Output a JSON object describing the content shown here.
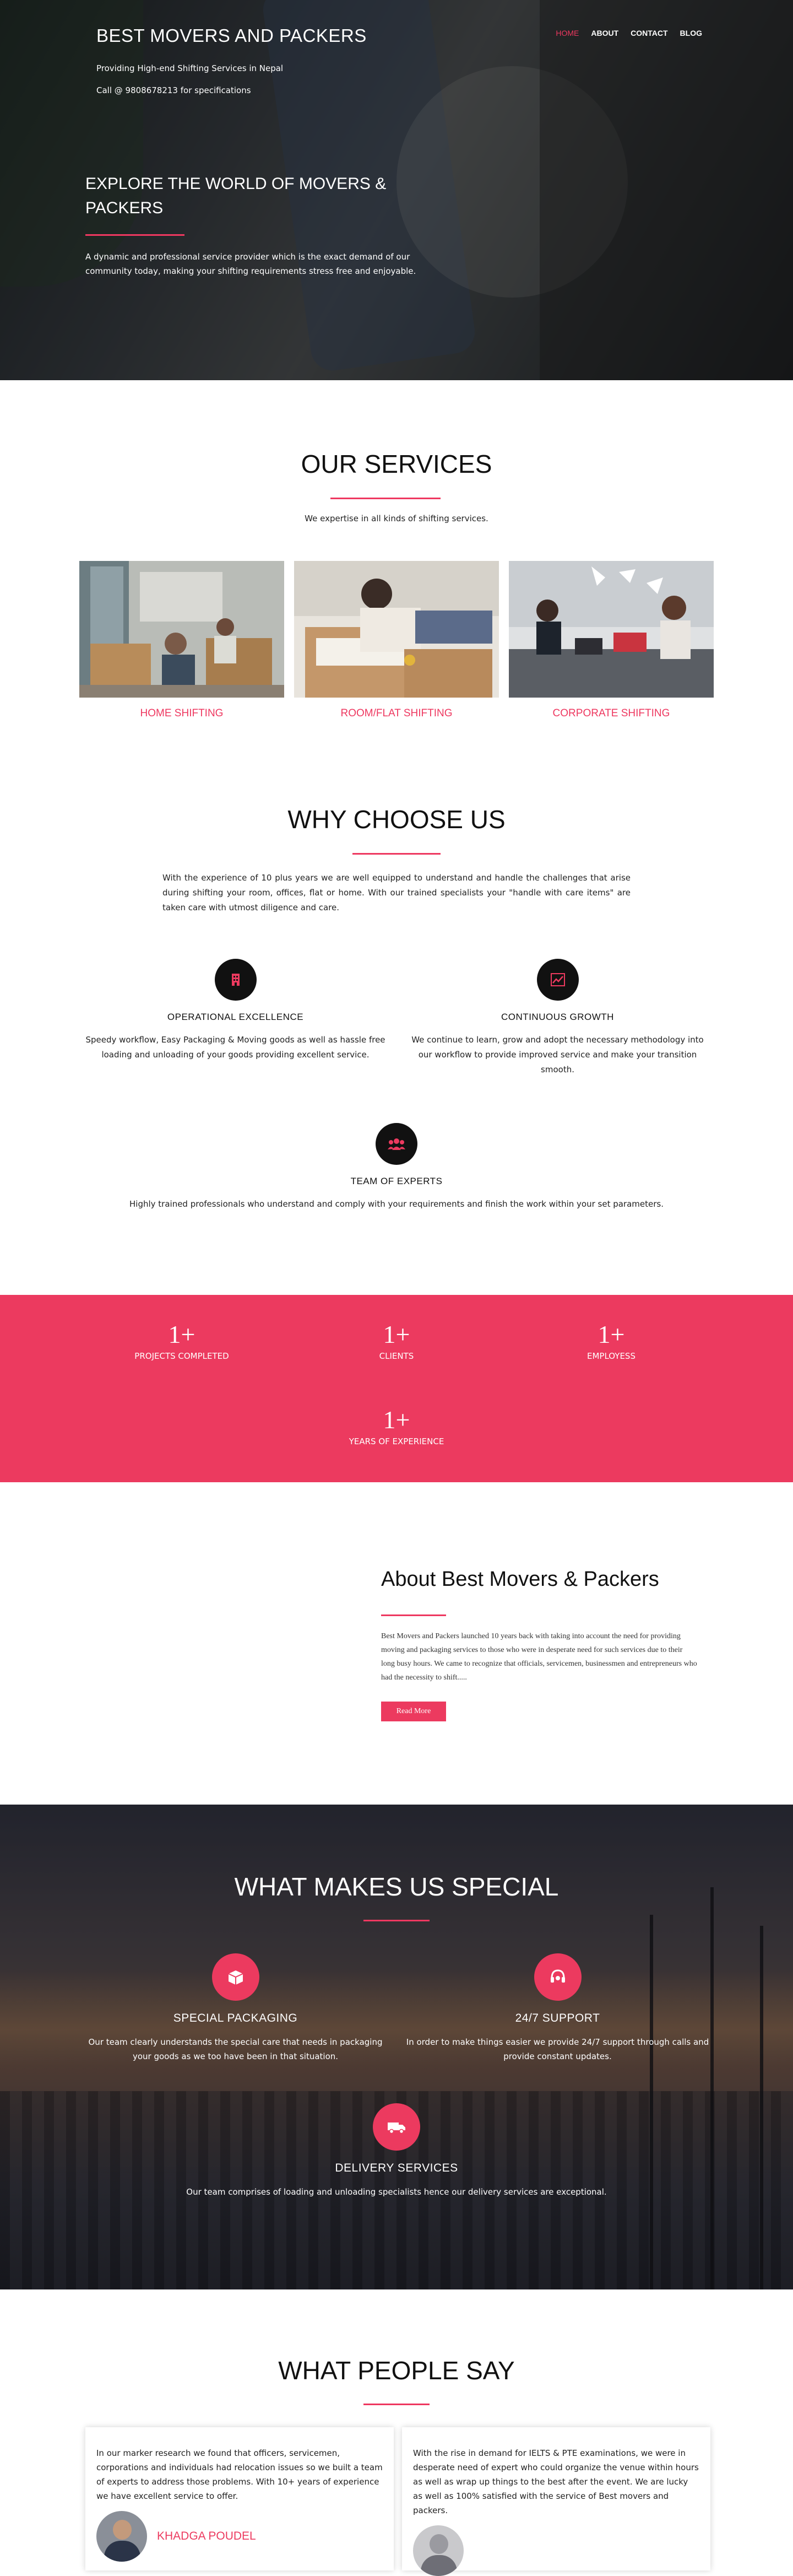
{
  "header": {
    "brand": "BEST MOVERS AND PACKERS",
    "tagline": "Providing High-end Shifting Services in Nepal",
    "call": "Call @ 9808678213 for specifications",
    "nav": [
      "HOME",
      "ABOUT",
      "CONTACT",
      "BLOG"
    ],
    "active_nav": "HOME"
  },
  "hero": {
    "title": "EXPLORE THE WORLD OF MOVERS & PACKERS",
    "description": "A dynamic and professional service provider which is the exact demand of our community today, making your shifting requirements stress free and enjoyable."
  },
  "services": {
    "title": "OUR SERVICES",
    "subtitle": "We expertise in all kinds of shifting services.",
    "items": [
      {
        "label": "HOME SHIFTING"
      },
      {
        "label": "ROOM/FLAT SHIFTING"
      },
      {
        "label": "CORPORATE SHIFTING"
      }
    ]
  },
  "why": {
    "title": "WHY CHOOSE US",
    "intro": "With the experience of 10 plus years we are well equipped to understand and handle the challenges that arise during shifting your room, offices, flat or home. With our trained specialists your \"handle with care items\" are taken care with utmost diligence and care.",
    "features": [
      {
        "icon": "building-icon",
        "title": "OPERATIONAL EXCELLENCE",
        "desc": "Speedy workflow, Easy Packaging & Moving goods as well as hassle free loading and unloading of your goods providing excellent service."
      },
      {
        "icon": "chart-growth-icon",
        "title": "CONTINUOUS GROWTH",
        "desc": "We continue to learn, grow and adopt the necessary methodology into our workflow to provide improved service  and make your transition smooth."
      },
      {
        "icon": "team-icon",
        "title": "TEAM OF EXPERTS",
        "desc": "Highly trained professionals who understand and comply with your requirements and finish the work within your set parameters."
      }
    ]
  },
  "stats": [
    {
      "num": "1+",
      "label": "PROJECTS COMPLETED"
    },
    {
      "num": "1+",
      "label": "CLIENTS"
    },
    {
      "num": "1+",
      "label": "EMPLOYESS"
    },
    {
      "num": "1+",
      "label": "YEARS OF EXPERIENCE"
    }
  ],
  "about": {
    "title": "About Best Movers & Packers",
    "text": "Best Movers and Packers launched 10 years back with taking into account the need for providing moving and packaging services to those who were in desperate need for such services due to their long busy hours. We came to recognize that officials, servicemen, businessmen and entrepreneurs who had the necessity to shift.....",
    "button": "Read More"
  },
  "special": {
    "title": "WHAT MAKES US SPECIAL",
    "items": [
      {
        "icon": "package-icon",
        "title": "SPECIAL PACKAGING",
        "desc": "Our team clearly understands the special care that needs in packaging your goods as we too have been in that situation."
      },
      {
        "icon": "headset-icon",
        "title": "24/7 SUPPORT",
        "desc": "In order to make things easier we provide 24/7 support through calls and provide constant updates."
      },
      {
        "icon": "truck-icon",
        "title": "DELIVERY SERVICES",
        "desc": "Our team comprises of loading and unloading specialists hence our delivery services are exceptional."
      }
    ]
  },
  "testimonials": {
    "title": "WHAT PEOPLE SAY",
    "items": [
      {
        "text": "In our marker research we found that officers, servicemen, corporations and individuals had relocation issues so we built a team of experts to address those problems. With 10+ years of experience we have excellent service to offer.",
        "name": "KHADGA POUDEL"
      },
      {
        "text": "With the rise in demand for IELTS & PTE examinations, we were in desperate need of expert who could organize the venue within hours as well as wrap up things to the best after the event. We are lucky as well as 100% satisfied with the service of Best movers and packers.",
        "name": ""
      }
    ]
  },
  "colors": {
    "accent": "#ec3a5f",
    "dark": "#111111"
  }
}
